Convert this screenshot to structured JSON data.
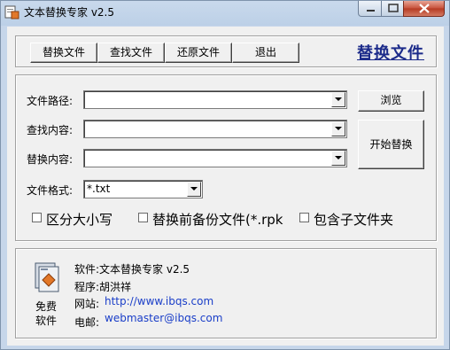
{
  "window": {
    "title": "文本替换专家 v2.5"
  },
  "toolbar": {
    "buttons": [
      {
        "label": "替换文件"
      },
      {
        "label": "查找文件"
      },
      {
        "label": "还原文件"
      },
      {
        "label": "退出"
      }
    ],
    "hero_title": "替换文件"
  },
  "form": {
    "path_label": "文件路径:",
    "path_value": "",
    "find_label": "查找内容:",
    "find_value": "",
    "replace_label": "替换内容:",
    "replace_value": "",
    "format_label": "文件格式:",
    "format_value": "*.txt",
    "browse_label": "浏览",
    "start_label": "开始替换"
  },
  "options": {
    "case_sensitive": {
      "label": "区分大小写",
      "checked": false
    },
    "backup": {
      "label": "替换前备份文件(*.rpk",
      "checked": false
    },
    "subfolders": {
      "label": "包含子文件夹",
      "checked": false
    }
  },
  "about": {
    "free_line1": "免费",
    "free_line2": "软件",
    "software": "软件:文本替换专家 v2.5",
    "author": "程序:胡洪祥",
    "site_label": "网站:",
    "site_url": "http://www.ibqs.com",
    "email_label": "电邮:",
    "email": "webmaster@ibqs.com"
  },
  "icons": {
    "app": "app-icon",
    "minimize": "minimize-icon",
    "maximize": "maximize-icon",
    "close": "close-icon",
    "dropdown": "chevron-down-icon",
    "free": "free-software-icon"
  },
  "colors": {
    "hero_title": "#1c2b8a",
    "link": "#1a3ec8",
    "close_button": "#c7503a",
    "panel_bg": "#f0f0f0"
  }
}
